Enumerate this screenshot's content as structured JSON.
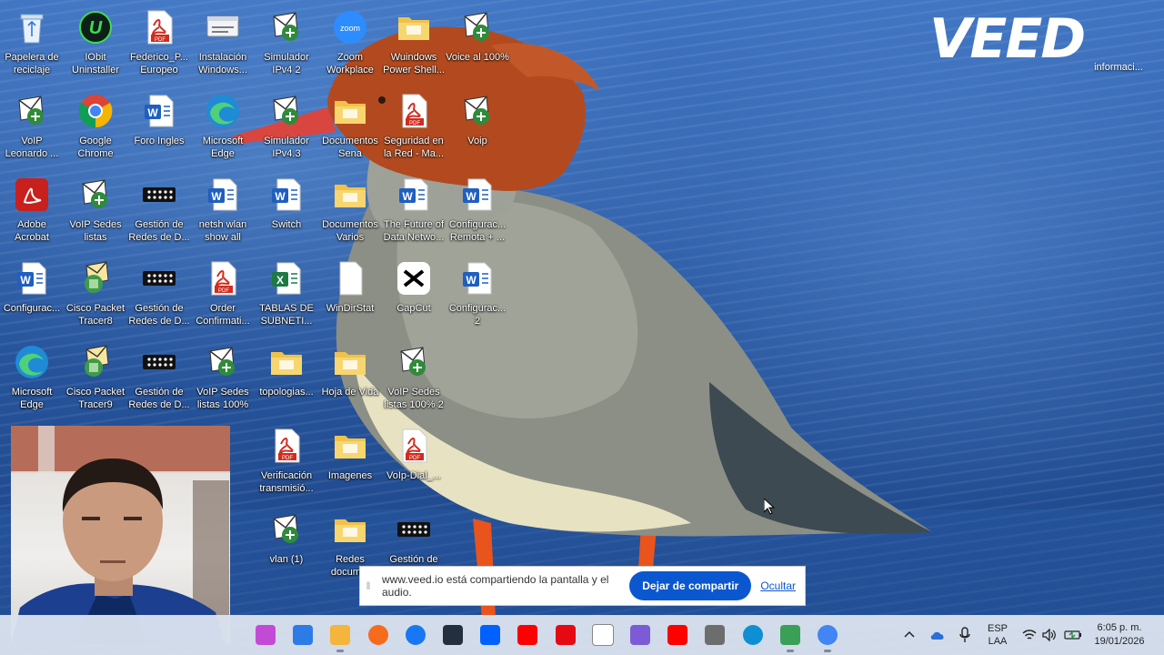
{
  "desktop": {
    "icons": [
      {
        "label": "Papelera de\nreciclaje",
        "icon": "recycle-bin-icon"
      },
      {
        "label": "IObit\nUninstaller",
        "icon": "iobit-icon"
      },
      {
        "label": "Federico_P...\nEuropeo",
        "icon": "pdf-icon"
      },
      {
        "label": "Instalación\nWindows...",
        "icon": "window-icon"
      },
      {
        "label": "Simulador\nIPv4 2",
        "icon": "packet-tracer-file-icon"
      },
      {
        "label": "Zoom\nWorkplace",
        "icon": "zoom-icon"
      },
      {
        "label": "Wuindows\nPower Shell...",
        "icon": "folder-icon"
      },
      {
        "label": "Voice al 100%",
        "icon": "packet-tracer-file-icon"
      },
      {
        "label": "VoIP\nLeonardo ...",
        "icon": "packet-tracer-file-icon"
      },
      {
        "label": "Google\nChrome",
        "icon": "chrome-icon"
      },
      {
        "label": "Foro Ingles",
        "icon": "word-icon"
      },
      {
        "label": "Microsoft\nEdge",
        "icon": "edge-icon"
      },
      {
        "label": "Simulador\nIPv4.3",
        "icon": "packet-tracer-file-icon"
      },
      {
        "label": "Documentos\nSena",
        "icon": "folder-icon"
      },
      {
        "label": "Seguridad en\nla Red - Ma...",
        "icon": "pdf-icon"
      },
      {
        "label": "Voip",
        "icon": "packet-tracer-file-icon"
      },
      {
        "label": "Adobe\nAcrobat",
        "icon": "acrobat-icon"
      },
      {
        "label": "VoIP Sedes\nlistas",
        "icon": "packet-tracer-file-icon"
      },
      {
        "label": "Gestión de\nRedes de D...",
        "icon": "network-device-icon"
      },
      {
        "label": "netsh wlan\nshow all",
        "icon": "word-icon"
      },
      {
        "label": "Switch",
        "icon": "word-icon"
      },
      {
        "label": "Documentos\nVarios",
        "icon": "folder-icon"
      },
      {
        "label": "The Future of\nData Netwo...",
        "icon": "word-icon"
      },
      {
        "label": "Configurac...\nRemota + ...",
        "icon": "word-icon"
      },
      {
        "label": "Configurac...",
        "icon": "word-icon"
      },
      {
        "label": "Cisco Packet\nTracer8",
        "icon": "packet-tracer-icon"
      },
      {
        "label": "Gestión de\nRedes de D...",
        "icon": "network-device-icon"
      },
      {
        "label": "Order\nConfirmati...",
        "icon": "pdf-icon"
      },
      {
        "label": "TABLAS DE\nSUBNETI...",
        "icon": "excel-icon"
      },
      {
        "label": "WinDirStat",
        "icon": "blank-file-icon"
      },
      {
        "label": "CapCut",
        "icon": "capcut-icon"
      },
      {
        "label": "Configurac...\n2",
        "icon": "word-icon"
      },
      {
        "label": "Microsoft\nEdge",
        "icon": "edge-icon"
      },
      {
        "label": "Cisco Packet\nTracer9",
        "icon": "packet-tracer-icon"
      },
      {
        "label": "Gestión de\nRedes de D...",
        "icon": "network-device-icon"
      },
      {
        "label": "VoIP Sedes\nlistas 100%",
        "icon": "packet-tracer-file-icon"
      },
      {
        "label": "topologias...",
        "icon": "folder-icon"
      },
      {
        "label": "Hoja de Vida",
        "icon": "folder-icon"
      },
      {
        "label": "VoIP Sedes\nlistas 100% 2",
        "icon": "packet-tracer-file-icon"
      },
      {
        "label": "Verificación\ntransmisió...",
        "icon": "pdf-icon"
      },
      {
        "label": "Imagenes",
        "icon": "folder-icon"
      },
      {
        "label": "VoIp-Dial_...",
        "icon": "pdf-icon"
      },
      {
        "label": "vlan (1)",
        "icon": "packet-tracer-file-icon"
      },
      {
        "label": "Redes\ndocum...",
        "icon": "folder-icon"
      },
      {
        "label": "Gestión de",
        "icon": "network-device-icon"
      }
    ],
    "veed_logo": "VEED",
    "info_label": "informaci..."
  },
  "share_banner": {
    "message": "www.veed.io está compartiendo la pantalla y el audio.",
    "stop_label": "Dejar de compartir",
    "hide_label": "Ocultar"
  },
  "taskbar": {
    "apps": [
      {
        "name": "copilot-icon",
        "color": "#c24bd6"
      },
      {
        "name": "microsoft-store-icon",
        "color": "#2d7be5"
      },
      {
        "name": "file-explorer-icon",
        "color": "#f3b53b"
      },
      {
        "name": "firefox-icon",
        "color": "#f76b1c"
      },
      {
        "name": "facebook-icon",
        "color": "#1877f2"
      },
      {
        "name": "amazon-icon",
        "color": "#232f3e"
      },
      {
        "name": "dropbox-icon",
        "color": "#0061ff"
      },
      {
        "name": "youtube-icon",
        "color": "#ff0000"
      },
      {
        "name": "netflix-icon",
        "color": "#e50914"
      },
      {
        "name": "wikipedia-icon",
        "color": "#ffffff"
      },
      {
        "name": "media-player-icon",
        "color": "#7b5cd6"
      },
      {
        "name": "youtube-icon",
        "color": "#ff0000"
      },
      {
        "name": "app-m-icon",
        "color": "#6d6d6d"
      },
      {
        "name": "edge-icon",
        "color": "#0f8fd3"
      },
      {
        "name": "packet-tracer-icon",
        "color": "#3aa057"
      },
      {
        "name": "chrome-icon",
        "color": "#4285f4"
      }
    ],
    "language_line1": "ESP",
    "language_line2": "LAA",
    "time": "6:05 p. m.",
    "date": "19/01/2026"
  }
}
